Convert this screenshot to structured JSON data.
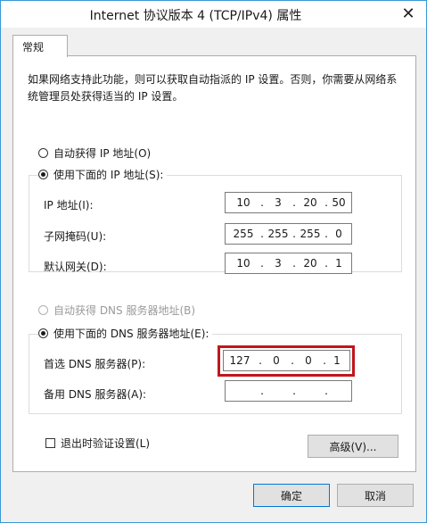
{
  "window": {
    "title": "Internet 协议版本 4 (TCP/IPv4) 属性",
    "close": "✕"
  },
  "tab": {
    "label": "常规"
  },
  "description": "如果网络支持此功能，则可以获取自动指派的 IP 设置。否则，你需要从网络系统管理员处获得适当的 IP 设置。",
  "ip": {
    "auto_label": "自动获得 IP 地址(O)",
    "manual_label": "使用下面的 IP 地址(S):",
    "address_label": "IP 地址(I):",
    "address": [
      "10",
      "3",
      "20",
      "50"
    ],
    "mask_label": "子网掩码(U):",
    "mask": [
      "255",
      "255",
      "255",
      "0"
    ],
    "gateway_label": "默认网关(D):",
    "gateway": [
      "10",
      "3",
      "20",
      "1"
    ]
  },
  "dns": {
    "auto_label": "自动获得 DNS 服务器地址(B)",
    "manual_label": "使用下面的 DNS 服务器地址(E):",
    "preferred_label": "首选 DNS 服务器(P):",
    "preferred": [
      "127",
      "0",
      "0",
      "1"
    ],
    "alternate_label": "备用 DNS 服务器(A):",
    "alternate": [
      "",
      "",
      "",
      ""
    ]
  },
  "validate_label": "退出时验证设置(L)",
  "advanced_label": "高级(V)...",
  "ok_label": "确定",
  "cancel_label": "取消",
  "dot": "."
}
